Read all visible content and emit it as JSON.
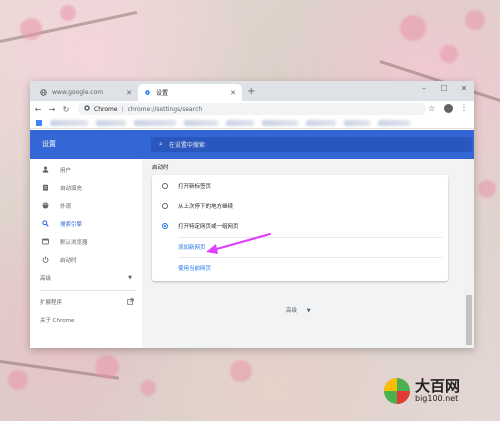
{
  "browser": {
    "tabs": [
      {
        "title": "www.google.com",
        "active": false
      },
      {
        "title": "设置",
        "active": true
      }
    ],
    "new_tab": "+",
    "window_controls": {
      "minimize": "–",
      "maximize": "☐",
      "close": "✕"
    },
    "address": {
      "origin": "Chrome",
      "url": "chrome://settings/search"
    }
  },
  "settings": {
    "title": "设置",
    "search_placeholder": "在设置中搜索",
    "nav": [
      {
        "label": "用户",
        "icon": "person-icon"
      },
      {
        "label": "自动填充",
        "icon": "clipboard-icon"
      },
      {
        "label": "外观",
        "icon": "palette-icon"
      },
      {
        "label": "搜索引擎",
        "icon": "search-icon",
        "selected": true
      },
      {
        "label": "默认浏览器",
        "icon": "browser-icon"
      },
      {
        "label": "启动时",
        "icon": "power-icon"
      }
    ],
    "advanced_nav": "高级",
    "extensions": "扩展程序",
    "about": "关于 Chrome",
    "section_title": "启动时",
    "startup_options": [
      {
        "label": "打开新标签页",
        "checked": false
      },
      {
        "label": "从上次停下的地方继续",
        "checked": false
      },
      {
        "label": "打开特定网页或一组网页",
        "checked": true
      }
    ],
    "add_new_page": "添加新网页",
    "use_current_pages": "使用当前网页",
    "advanced_footer": "高级"
  },
  "watermark": {
    "brand": "大百网",
    "url": "big100.net"
  },
  "colors": {
    "header": "#3367d6",
    "accent": "#1a73e8",
    "arrow": "#e040fb"
  }
}
